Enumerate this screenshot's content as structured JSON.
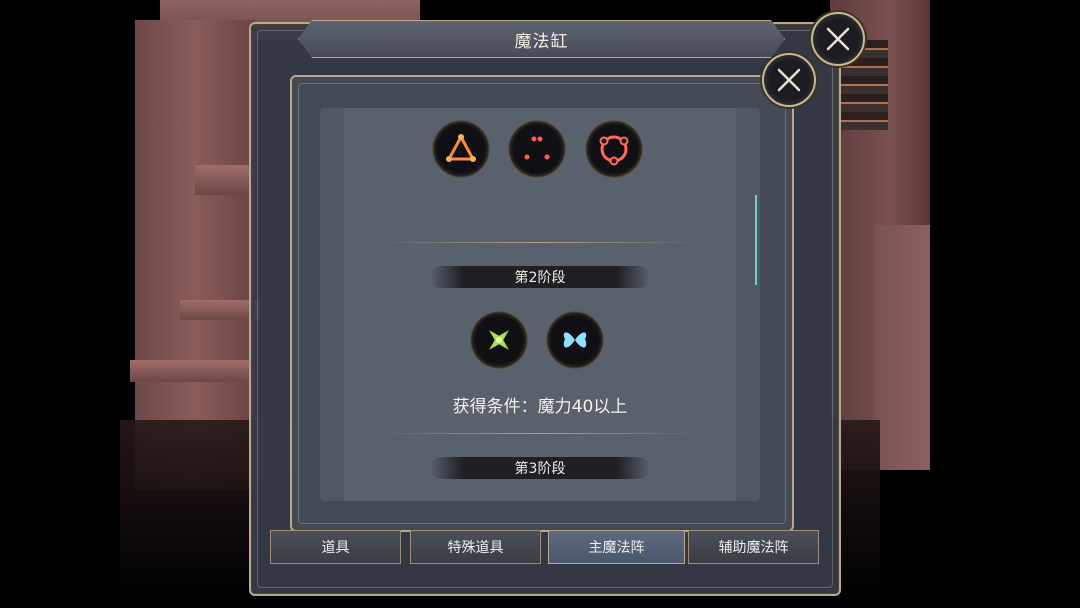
{
  "dialog": {
    "title": "魔法缸"
  },
  "stages": [
    {
      "label": "",
      "icons": [
        "triangle-rune-icon",
        "dots-rune-icon",
        "circle-link-rune-icon"
      ]
    },
    {
      "label": "第2阶段",
      "icons": [
        "green-star-rune-icon",
        "blue-butterfly-rune-icon"
      ],
      "condition": "获得条件：魔力40以上"
    },
    {
      "label": "第3阶段",
      "icons": []
    }
  ],
  "tabs": [
    {
      "label": "道具",
      "active": false
    },
    {
      "label": "特殊道具",
      "active": false
    },
    {
      "label": "主魔法阵",
      "active": true
    },
    {
      "label": "辅助魔法阵",
      "active": false
    }
  ],
  "colors": {
    "frame_gold": "#b8a98c",
    "rune_orange": "#ff8a3a",
    "rune_red": "#ff5a5a",
    "rune_green": "#a8e050",
    "rune_blue": "#8fe0ff",
    "scroll_accent": "#6fd0c8"
  }
}
